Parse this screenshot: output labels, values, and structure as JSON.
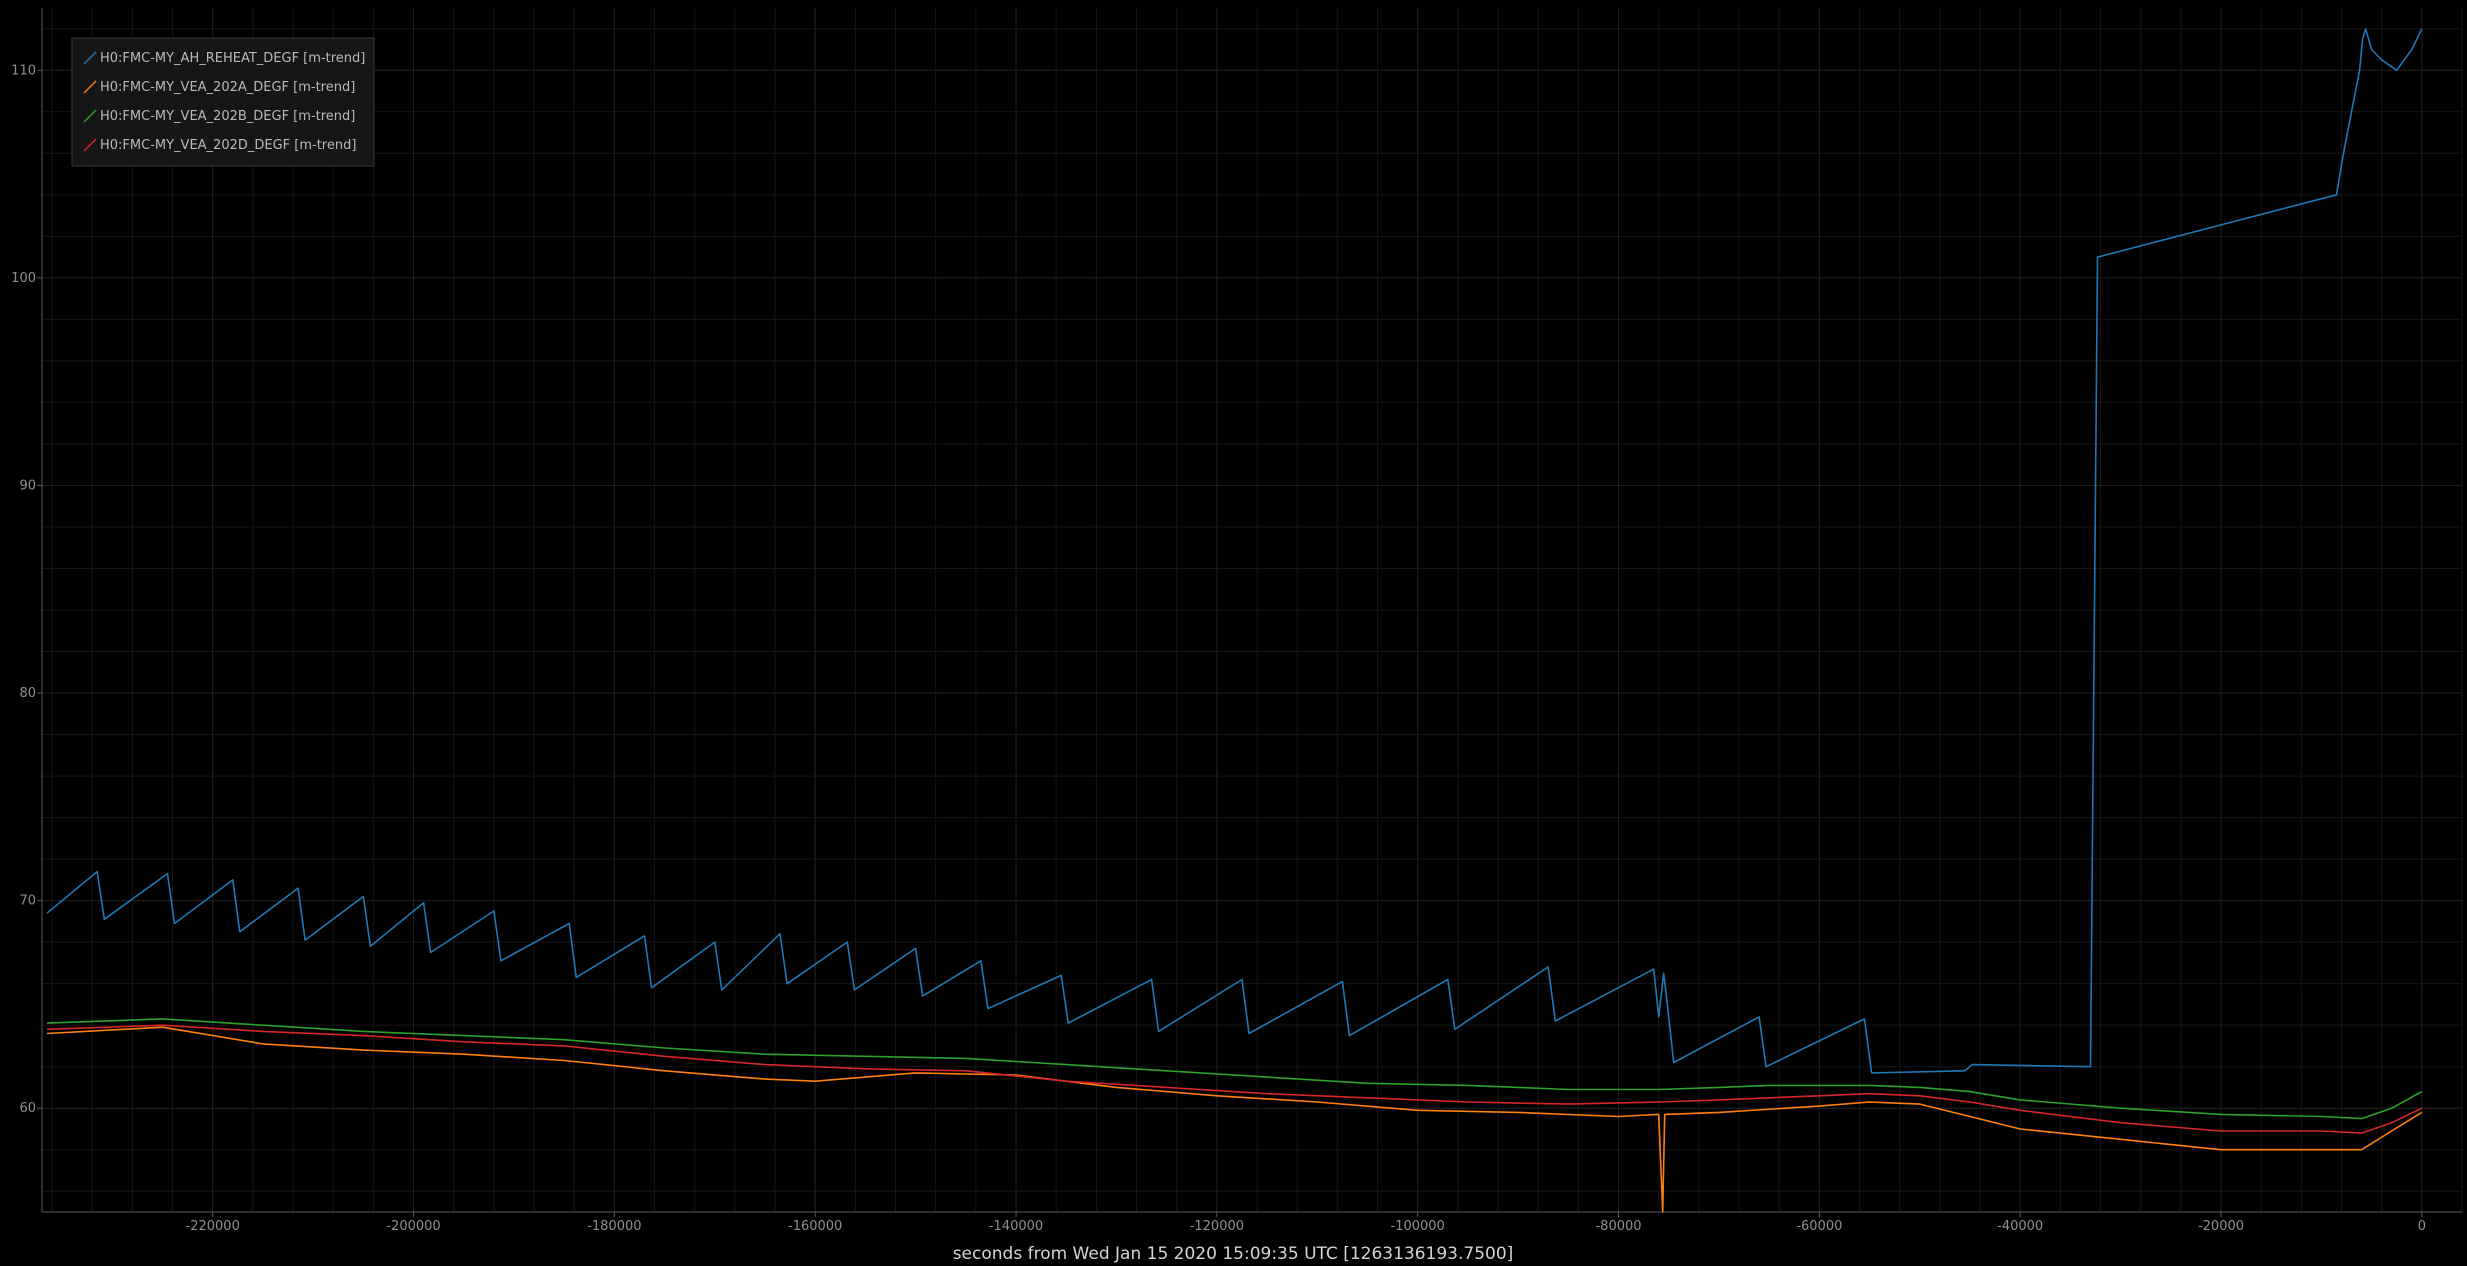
{
  "chart_data": {
    "type": "line",
    "xlabel": "seconds from Wed Jan 15 2020 15:09:35 UTC [1263136193.7500]",
    "ylabel": "",
    "xlim": [
      -237000,
      4000
    ],
    "ylim": [
      55,
      113
    ],
    "x_ticks": [
      -220000,
      -200000,
      -180000,
      -160000,
      -140000,
      -120000,
      -100000,
      -80000,
      -60000,
      -40000,
      -20000,
      0
    ],
    "y_ticks": [
      60,
      70,
      80,
      90,
      100,
      110
    ],
    "x_tick_labels": [
      "-220000",
      "-200000",
      "-180000",
      "-160000",
      "-140000",
      "-120000",
      "-100000",
      "-80000",
      "-60000",
      "-40000",
      "-20000",
      "0"
    ],
    "y_tick_labels": [
      "60",
      "70",
      "80",
      "90",
      "100",
      "110"
    ],
    "grid": true,
    "legend_position": "top-left",
    "series": [
      {
        "name": "H0:FMC-MY_AH_REHEAT_DEGF [m-trend]",
        "color": "#1f77b4",
        "x": [
          -236500,
          -231500,
          -230800,
          -224500,
          -223800,
          -218000,
          -217300,
          -211500,
          -210800,
          -205000,
          -204300,
          -199000,
          -198300,
          -192000,
          -191300,
          -184500,
          -183800,
          -177000,
          -176300,
          -170000,
          -169300,
          -163500,
          -162800,
          -156800,
          -156100,
          -150000,
          -149300,
          -143500,
          -142800,
          -135500,
          -134800,
          -126500,
          -125800,
          -117500,
          -116800,
          -107500,
          -106800,
          -97000,
          -96300,
          -87000,
          -86300,
          -76500,
          -76000,
          -75500,
          -75000,
          -74500,
          -66000,
          -65300,
          -55500,
          -54800,
          -45500,
          -44800,
          -33000,
          -32300,
          -8500,
          -7800,
          -7000,
          -6200,
          -5900,
          -5600,
          -5300,
          -5000,
          -4000,
          -2500,
          -1000,
          0
        ],
        "values": [
          69.4,
          71.4,
          69.1,
          71.3,
          68.9,
          71.0,
          68.5,
          70.6,
          68.1,
          70.2,
          67.8,
          69.9,
          67.5,
          69.5,
          67.1,
          68.9,
          66.3,
          68.3,
          65.8,
          68.0,
          65.7,
          68.4,
          66.0,
          68.0,
          65.7,
          67.7,
          65.4,
          67.1,
          64.8,
          66.4,
          64.1,
          66.2,
          63.7,
          66.2,
          63.6,
          66.1,
          63.5,
          66.2,
          63.8,
          66.8,
          64.2,
          66.7,
          64.4,
          66.5,
          64.4,
          62.2,
          64.4,
          62.0,
          64.3,
          61.7,
          61.8,
          62.1,
          62.0,
          101.0,
          104.0,
          106.0,
          108.0,
          110.0,
          111.5,
          112.0,
          111.5,
          111.0,
          110.5,
          110.0,
          111.0,
          112.0
        ],
        "note": ""
      },
      {
        "name": "H0:FMC-MY_VEA_202A_DEGF [m-trend]",
        "color": "#ff7f0e",
        "x": [
          -236500,
          -225000,
          -215000,
          -205000,
          -195000,
          -185000,
          -175000,
          -165000,
          -160000,
          -150000,
          -140000,
          -130000,
          -120000,
          -110000,
          -100000,
          -90000,
          -80000,
          -76000,
          -75600,
          -75400,
          -70000,
          -60000,
          -55000,
          -50000,
          -45000,
          -40000,
          -30000,
          -20000,
          -10000,
          -6000,
          -3000,
          0
        ],
        "values": [
          63.6,
          63.9,
          63.1,
          62.8,
          62.6,
          62.3,
          61.8,
          61.4,
          61.3,
          61.7,
          61.6,
          61.0,
          60.6,
          60.3,
          59.9,
          59.8,
          59.6,
          59.7,
          55.0,
          59.7,
          59.8,
          60.1,
          60.3,
          60.2,
          59.6,
          59.0,
          58.5,
          58.0,
          58.0,
          58.0,
          58.9,
          59.8
        ]
      },
      {
        "name": "H0:FMC-MY_VEA_202B_DEGF [m-trend]",
        "color": "#2ca02c",
        "x": [
          -236500,
          -225000,
          -215000,
          -205000,
          -195000,
          -185000,
          -175000,
          -165000,
          -155000,
          -145000,
          -135000,
          -125000,
          -115000,
          -105000,
          -95000,
          -85000,
          -76000,
          -70000,
          -65000,
          -55000,
          -50000,
          -45000,
          -40000,
          -30000,
          -20000,
          -10000,
          -6000,
          -3000,
          0
        ],
        "values": [
          64.1,
          64.3,
          64.0,
          63.7,
          63.5,
          63.3,
          62.9,
          62.6,
          62.5,
          62.4,
          62.1,
          61.8,
          61.5,
          61.2,
          61.1,
          60.9,
          60.9,
          61.0,
          61.1,
          61.1,
          61.0,
          60.8,
          60.4,
          60.0,
          59.7,
          59.6,
          59.5,
          60.0,
          60.8
        ]
      },
      {
        "name": "H0:FMC-MY_VEA_202D_DEGF [m-trend]",
        "color": "#d62728",
        "x": [
          -236500,
          -225000,
          -215000,
          -205000,
          -195000,
          -185000,
          -175000,
          -165000,
          -155000,
          -145000,
          -135000,
          -125000,
          -115000,
          -105000,
          -95000,
          -85000,
          -76000,
          -70000,
          -60000,
          -55000,
          -50000,
          -45000,
          -40000,
          -30000,
          -20000,
          -10000,
          -6000,
          -3000,
          0
        ],
        "values": [
          63.8,
          64.0,
          63.7,
          63.5,
          63.2,
          63.0,
          62.5,
          62.1,
          61.9,
          61.8,
          61.3,
          61.0,
          60.7,
          60.5,
          60.3,
          60.2,
          60.3,
          60.4,
          60.6,
          60.7,
          60.6,
          60.3,
          59.9,
          59.3,
          58.9,
          58.9,
          58.8,
          59.3,
          60.0
        ]
      }
    ]
  }
}
